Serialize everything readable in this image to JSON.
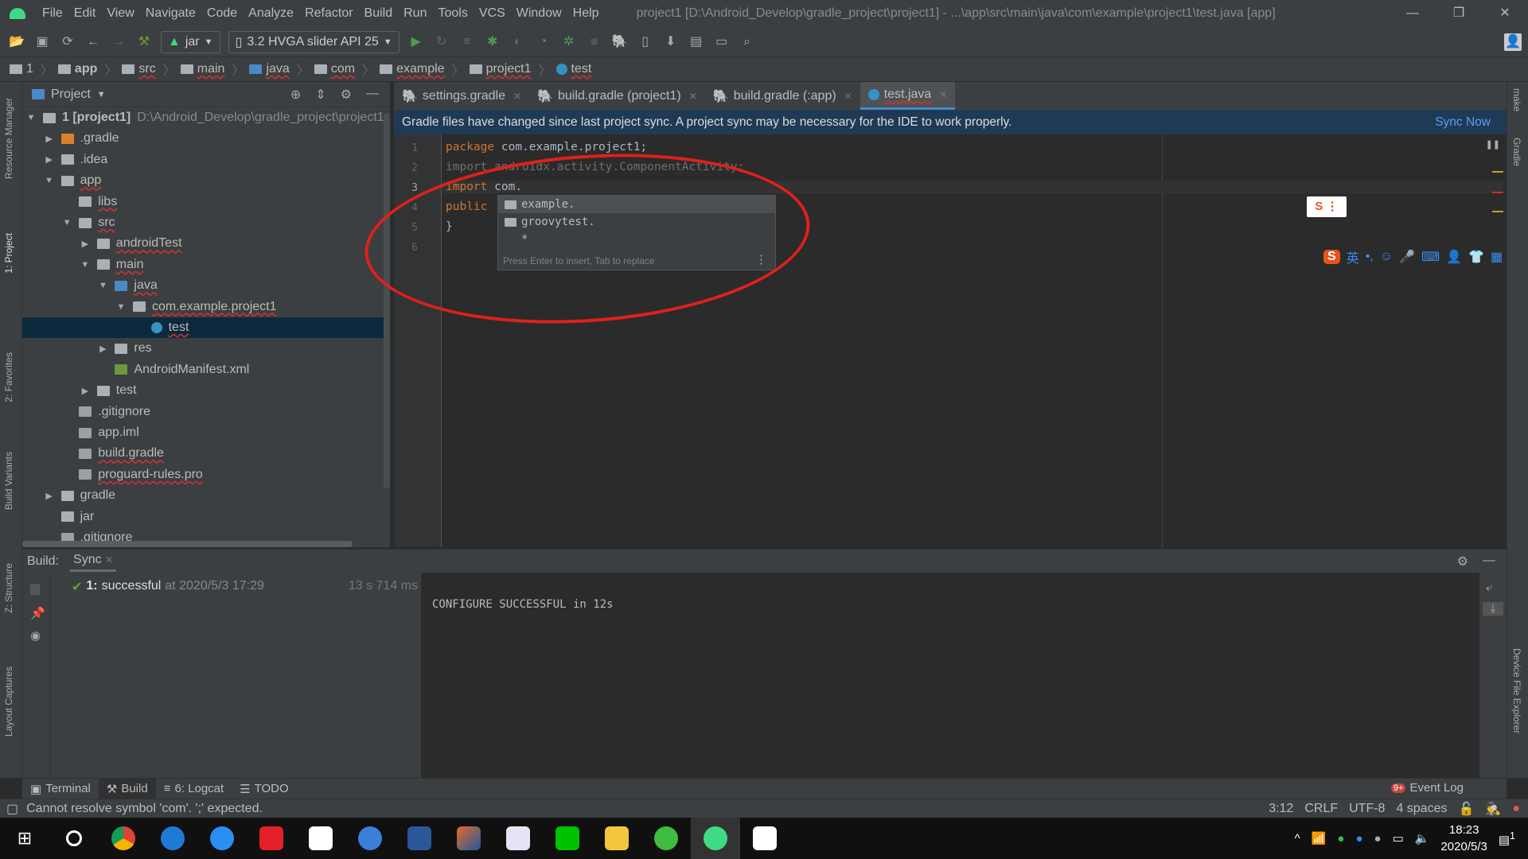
{
  "menubar": {
    "items": [
      "File",
      "Edit",
      "View",
      "Navigate",
      "Code",
      "Analyze",
      "Refactor",
      "Build",
      "Run",
      "Tools",
      "VCS",
      "Window",
      "Help"
    ],
    "title": "project1 [D:\\Android_Develop\\gradle_project\\project1] - ...\\app\\src\\main\\java\\com\\example\\project1\\test.java [app]"
  },
  "toolbar": {
    "module": "jar",
    "device": "3.2  HVGA slider API 25"
  },
  "breadcrumbs": [
    "1",
    "app",
    "src",
    "main",
    "java",
    "com",
    "example",
    "project1",
    "test"
  ],
  "project_panel": {
    "title": "Project",
    "tree": [
      {
        "label": "1 [project1]",
        "path": "D:\\Android_Develop\\gradle_project\\project1",
        "level": 0,
        "state": "expanded",
        "icon": "module"
      },
      {
        "label": ".gradle",
        "level": 1,
        "state": "collapsed",
        "icon": "folder-orange"
      },
      {
        "label": ".idea",
        "level": 1,
        "state": "collapsed",
        "icon": "folder"
      },
      {
        "label": "app",
        "level": 1,
        "state": "expanded",
        "icon": "module-folder"
      },
      {
        "label": "libs",
        "level": 2,
        "state": "none",
        "icon": "folder"
      },
      {
        "label": "src",
        "level": 2,
        "state": "expanded",
        "icon": "folder"
      },
      {
        "label": "androidTest",
        "level": 3,
        "state": "collapsed",
        "icon": "folder"
      },
      {
        "label": "main",
        "level": 3,
        "state": "expanded",
        "icon": "folder"
      },
      {
        "label": "java",
        "level": 4,
        "state": "expanded",
        "icon": "folder-blue"
      },
      {
        "label": "com.example.project1",
        "level": 5,
        "state": "expanded",
        "icon": "package"
      },
      {
        "label": "test",
        "level": 6,
        "state": "none",
        "icon": "class",
        "selected": true
      },
      {
        "label": "res",
        "level": 4,
        "state": "collapsed",
        "icon": "folder-res"
      },
      {
        "label": "AndroidManifest.xml",
        "level": 4,
        "state": "none",
        "icon": "manifest"
      },
      {
        "label": "test",
        "level": 3,
        "state": "collapsed",
        "icon": "folder"
      },
      {
        "label": ".gitignore",
        "level": 2,
        "state": "none",
        "icon": "file"
      },
      {
        "label": "app.iml",
        "level": 2,
        "state": "none",
        "icon": "file"
      },
      {
        "label": "build.gradle",
        "level": 2,
        "state": "none",
        "icon": "gradle"
      },
      {
        "label": "proguard-rules.pro",
        "level": 2,
        "state": "none",
        "icon": "file"
      },
      {
        "label": "gradle",
        "level": 1,
        "state": "collapsed",
        "icon": "folder"
      },
      {
        "label": "jar",
        "level": 1,
        "state": "none",
        "icon": "folder"
      },
      {
        "label": ".gitignore",
        "level": 1,
        "state": "none",
        "icon": "file"
      }
    ]
  },
  "tabs": [
    {
      "label": "settings.gradle"
    },
    {
      "label": "build.gradle (project1)"
    },
    {
      "label": "build.gradle (:app)"
    },
    {
      "label": "test.java",
      "active": true
    }
  ],
  "notice": {
    "text": "Gradle files have changed since last project sync. A project sync may be necessary for the IDE to work properly.",
    "action": "Sync Now"
  },
  "editor": {
    "lines": [
      {
        "n": "1",
        "kw": "package",
        "rest": " com.example.project1;"
      },
      {
        "n": "2",
        "kw": "",
        "rest": "import androidx.activity.ComponentActivity;",
        "dim": true
      },
      {
        "n": "3",
        "kw": "import",
        "rest": " com."
      },
      {
        "n": "4",
        "kw": "public",
        "rest": ""
      },
      {
        "n": "5",
        "kw": "",
        "rest": "}"
      },
      {
        "n": "6",
        "kw": "",
        "rest": ""
      }
    ]
  },
  "completion": {
    "items": [
      "example.",
      "groovytest.",
      "*"
    ],
    "hint": "Press Enter to insert, Tab to replace"
  },
  "build": {
    "label": "Build:",
    "tab": "Sync",
    "result_num": "1:",
    "result": "successful",
    "result_time": "at 2020/5/3 17:29",
    "duration": "13 s 714 ms",
    "console": "CONFIGURE SUCCESSFUL in 12s"
  },
  "bottom_tabs": [
    "Terminal",
    "Build",
    "6: Logcat",
    "TODO"
  ],
  "event_log": {
    "label": "Event Log",
    "badge": "9+"
  },
  "left_tools": [
    "Resource Manager",
    "1: Project",
    "2: Favorites",
    "Build Variants",
    "Z: Structure",
    "Layout Captures"
  ],
  "right_tools": [
    "make",
    "Gradle",
    "Device File Explorer"
  ],
  "status": {
    "message": "Cannot resolve symbol 'com'. ';' expected.",
    "position": "3:12",
    "line_sep": "CRLF",
    "encoding": "UTF-8",
    "indent": "4 spaces"
  },
  "taskbar": {
    "time": "18:23",
    "date": "2020/5/3",
    "notifications": "1"
  },
  "ime": {
    "label": "英"
  },
  "colors": {
    "accent": "#4a88c7",
    "notice_bg": "#1f3a56",
    "link": "#589df6",
    "keyword": "#cc7832",
    "annotation": "#e0201a"
  }
}
